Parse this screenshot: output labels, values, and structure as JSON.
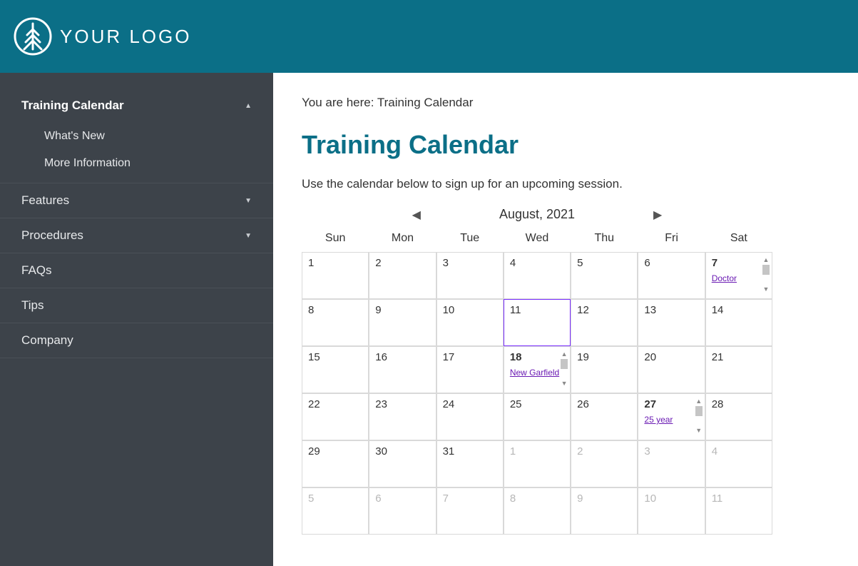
{
  "header": {
    "logo_text": "YOUR LOGO"
  },
  "sidebar": {
    "items": [
      {
        "label": "Training Calendar",
        "expanded": true,
        "children": [
          {
            "label": "What's New"
          },
          {
            "label": "More Information"
          }
        ]
      },
      {
        "label": "Features",
        "expandable": true
      },
      {
        "label": "Procedures",
        "expandable": true
      },
      {
        "label": "FAQs"
      },
      {
        "label": "Tips"
      },
      {
        "label": "Company"
      }
    ]
  },
  "breadcrumb": {
    "prefix": "You are here: ",
    "current": "Training Calendar"
  },
  "page": {
    "title": "Training Calendar",
    "description": "Use the calendar below to sign up for an upcoming session."
  },
  "calendar": {
    "month_label": "August, 2021",
    "day_headers": [
      "Sun",
      "Mon",
      "Tue",
      "Wed",
      "Thu",
      "Fri",
      "Sat"
    ],
    "weeks": [
      [
        {
          "n": "1"
        },
        {
          "n": "2"
        },
        {
          "n": "3"
        },
        {
          "n": "4"
        },
        {
          "n": "5"
        },
        {
          "n": "6"
        },
        {
          "n": "7",
          "bold": true,
          "event": "Doctor",
          "scroll": true
        }
      ],
      [
        {
          "n": "8"
        },
        {
          "n": "9"
        },
        {
          "n": "10"
        },
        {
          "n": "11",
          "today": true
        },
        {
          "n": "12"
        },
        {
          "n": "13"
        },
        {
          "n": "14"
        }
      ],
      [
        {
          "n": "15"
        },
        {
          "n": "16"
        },
        {
          "n": "17"
        },
        {
          "n": "18",
          "bold": true,
          "event": "New Garfield",
          "scroll": true
        },
        {
          "n": "19"
        },
        {
          "n": "20"
        },
        {
          "n": "21"
        }
      ],
      [
        {
          "n": "22"
        },
        {
          "n": "23"
        },
        {
          "n": "24"
        },
        {
          "n": "25"
        },
        {
          "n": "26"
        },
        {
          "n": "27",
          "bold": true,
          "event": "25 year",
          "scroll": true
        },
        {
          "n": "28"
        }
      ],
      [
        {
          "n": "29"
        },
        {
          "n": "30"
        },
        {
          "n": "31"
        },
        {
          "n": "1",
          "outside": true
        },
        {
          "n": "2",
          "outside": true
        },
        {
          "n": "3",
          "outside": true
        },
        {
          "n": "4",
          "outside": true
        }
      ],
      [
        {
          "n": "5",
          "outside": true
        },
        {
          "n": "6",
          "outside": true
        },
        {
          "n": "7",
          "outside": true
        },
        {
          "n": "8",
          "outside": true
        },
        {
          "n": "9",
          "outside": true
        },
        {
          "n": "10",
          "outside": true
        },
        {
          "n": "11",
          "outside": true
        }
      ]
    ]
  }
}
